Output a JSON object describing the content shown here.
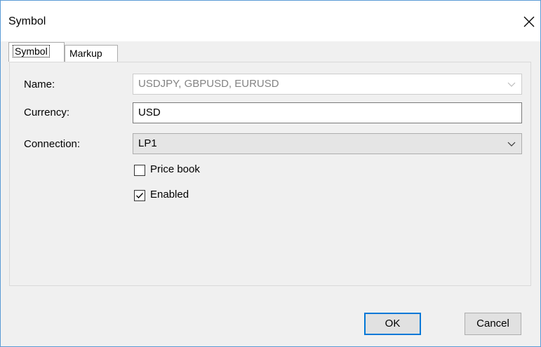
{
  "window": {
    "title": "Symbol"
  },
  "tabs": [
    {
      "label": "Symbol",
      "active": true
    },
    {
      "label": "Markup",
      "active": false
    }
  ],
  "form": {
    "name_label": "Name:",
    "name_value": "USDJPY, GBPUSD, EURUSD",
    "currency_label": "Currency:",
    "currency_value": "USD",
    "connection_label": "Connection:",
    "connection_value": "LP1",
    "price_book_label": "Price book",
    "price_book_checked": false,
    "enabled_label": "Enabled",
    "enabled_checked": true
  },
  "buttons": {
    "ok_label": "OK",
    "cancel_label": "Cancel"
  },
  "colors": {
    "window_border": "#5b9bd5",
    "default_button_border": "#0078d7",
    "dialog_background": "#f0f0f0"
  },
  "icons": {
    "close": "close-icon",
    "dropdown": "chevron-down-icon",
    "check": "checkmark-icon"
  }
}
